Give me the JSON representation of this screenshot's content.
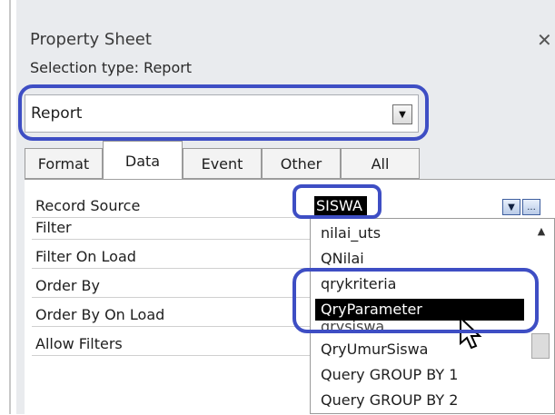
{
  "panel": {
    "title": "Property Sheet",
    "selection_type": "Selection type:  Report"
  },
  "combo": {
    "value": "Report"
  },
  "tabs": [
    "Format",
    "Data",
    "Event",
    "Other",
    "All"
  ],
  "active_tab": "Data",
  "properties": [
    "Record Source",
    "Filter",
    "Filter On Load",
    "Order By",
    "Order By On Load",
    "Allow Filters"
  ],
  "record_source": {
    "value": "SISWA",
    "dropdown_button": "dropdown-arrow",
    "builder_button": "..."
  },
  "dropdown": {
    "items": [
      "nilai_uts",
      "QNilai",
      "qrykriteria",
      "QryParameter",
      "qrysiswa",
      "QryUmurSiswa",
      "Query GROUP BY 1",
      "Query GROUP BY 2"
    ],
    "selected": "QryParameter"
  },
  "colors": {
    "highlight": "#3e4ec4",
    "selection": "#000000",
    "panel_bg": "#e9ebee"
  }
}
